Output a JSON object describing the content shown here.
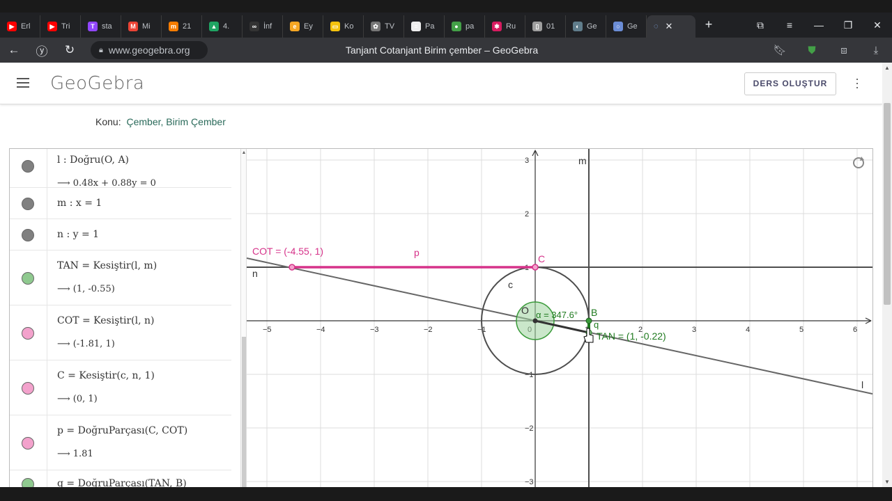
{
  "browser": {
    "tabs": [
      {
        "label": "Erl",
        "color": "#ff0000",
        "glyph": "▶"
      },
      {
        "label": "Tri",
        "color": "#ff0000",
        "glyph": "▶"
      },
      {
        "label": "sta",
        "color": "#9146ff",
        "glyph": "T"
      },
      {
        "label": "Mi",
        "color": "#ea4335",
        "glyph": "M"
      },
      {
        "label": "21",
        "color": "#f57c00",
        "glyph": "m"
      },
      {
        "label": "4.",
        "color": "#1fa463",
        "glyph": "▲"
      },
      {
        "label": "İnf",
        "color": "#333333",
        "glyph": "∞"
      },
      {
        "label": "Ey",
        "color": "#f5a623",
        "glyph": "e"
      },
      {
        "label": "Ko",
        "color": "#f4c20d",
        "glyph": "▭"
      },
      {
        "label": "TV",
        "color": "#777777",
        "glyph": "✿"
      },
      {
        "label": "Pa",
        "color": "#eeeeee",
        "glyph": "≡"
      },
      {
        "label": "pa",
        "color": "#43a047",
        "glyph": "●"
      },
      {
        "label": "Ru",
        "color": "#d81b60",
        "glyph": "✱"
      },
      {
        "label": "01",
        "color": "#9e9e9e",
        "glyph": "▯"
      },
      {
        "label": "Ge",
        "color": "#607d8b",
        "glyph": "◐"
      },
      {
        "label": "Ge",
        "color": "#6b8dd6",
        "glyph": "○"
      }
    ],
    "active_tab_glyph": "◌",
    "url": "www.geogebra.org",
    "title": "Tanjant Cotanjant Birim çember – GeoGebra"
  },
  "geogebra": {
    "logo": "GeoGebra",
    "create_button": "DERS OLUŞTUR",
    "topic_label": "Konu:",
    "topic_tags": "Çember, Birim Çember"
  },
  "algebra": [
    {
      "def": "l : Doğru(O, A)",
      "out": "⟶ 0.48x + 0.88y = 0",
      "color": "#808080"
    },
    {
      "def": "m : x = 1",
      "out": "",
      "color": "#808080"
    },
    {
      "def": "n : y = 1",
      "out": "",
      "color": "#808080"
    },
    {
      "def": "TAN = Kesiştir(l, m)",
      "out": "⟶ (1, -0.55)",
      "color": "#8fc98f"
    },
    {
      "def": "COT = Kesiştir(l, n)",
      "out": "⟶ (-1.81, 1)",
      "color": "#f3a2cc"
    },
    {
      "def": "C = Kesiştir(c, n, 1)",
      "out": "⟶ (0, 1)",
      "color": "#f3a2cc"
    },
    {
      "def": "p = DoğruParçası(C, COT)",
      "out": "⟶ 1.81",
      "color": "#f3a2cc"
    },
    {
      "def": "q = DoğruParçası(TAN, B)",
      "out": "",
      "color": "#8fc98f"
    }
  ],
  "graph": {
    "x_ticks": [
      "−5",
      "−4",
      "−3",
      "−2",
      "−1",
      "0",
      "1",
      "2",
      "3",
      "4",
      "5",
      "6"
    ],
    "y_ticks": [
      "3",
      "2",
      "1",
      "−1",
      "−2",
      "−3"
    ],
    "labels": {
      "cot": "COT = (-4.55, 1)",
      "p": "p",
      "C": "C",
      "n": "n",
      "c": "c",
      "O": "O",
      "alpha": "α = 347.6°",
      "B": "B",
      "q": "q",
      "tan": "TAN = (1, -0.22)",
      "m": "m",
      "l": "l"
    },
    "colors": {
      "pink": "#d6338a",
      "green": "#1f7a1f",
      "line": "#4d4d4d"
    }
  }
}
